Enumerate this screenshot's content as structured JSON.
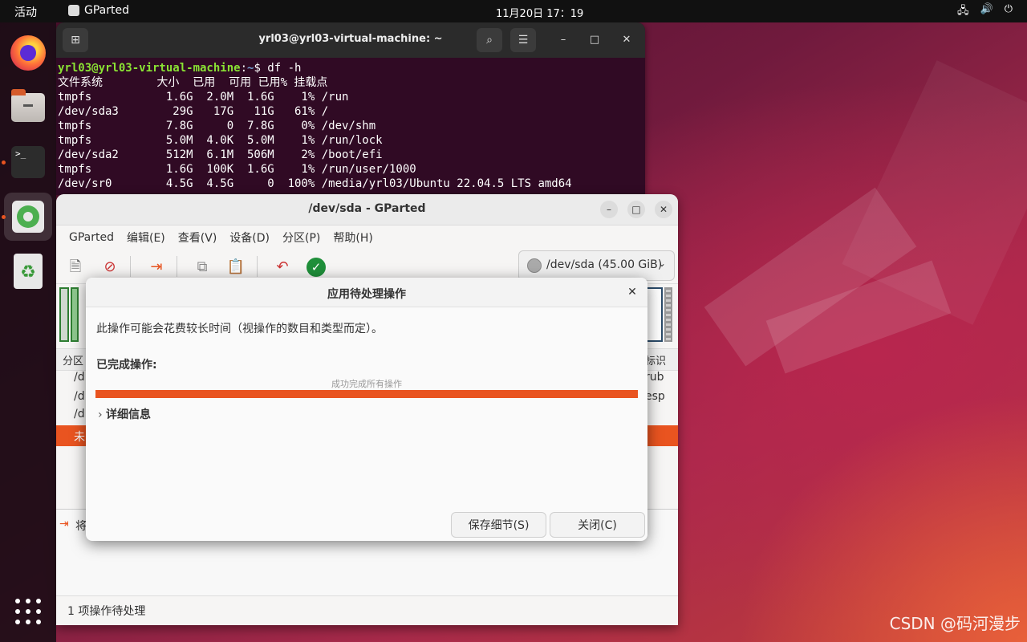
{
  "topbar": {
    "activities": "活动",
    "app_name": "GParted",
    "clock": "11月20日  17：19",
    "tray": [
      "network-icon",
      "volume-icon",
      "power-icon"
    ]
  },
  "dock": {
    "items": [
      "firefox",
      "files",
      "terminal",
      "gparted",
      "trash",
      "show-apps"
    ]
  },
  "terminal": {
    "title": "yrl03@yrl03-virtual-machine: ~",
    "prompt_user": "yrl03@yrl03-virtual-machine",
    "prompt_sep": ":",
    "prompt_path": "~",
    "prompt_cmd": "$ df -h",
    "lines": [
      "文件系统        大小  已用  可用 已用% 挂载点",
      "tmpfs           1.6G  2.0M  1.6G    1% /run",
      "/dev/sda3        29G   17G   11G   61% /",
      "tmpfs           7.8G     0  7.8G    0% /dev/shm",
      "tmpfs           5.0M  4.0K  5.0M    1% /run/lock",
      "/dev/sda2       512M  6.1M  506M    2% /boot/efi",
      "tmpfs           1.6G  100K  1.6G    1% /run/user/1000",
      "/dev/sr0        4.5G  4.5G     0  100% /media/yrl03/Ubuntu 22.04.5 LTS amd64"
    ]
  },
  "gparted": {
    "title": "/dev/sda - GParted",
    "menu": [
      "GParted",
      "编辑(E)",
      "查看(V)",
      "设备(D)",
      "分区(P)",
      "帮助(H)"
    ],
    "device": "/dev/sda (45.00 GiB)",
    "list_header_left": "分区",
    "list_header_right": "标识",
    "rows": [
      {
        "left": "/d",
        "right": "rub"
      },
      {
        "left": "/d",
        "right": "esp"
      },
      {
        "left": "/d",
        "right": ""
      }
    ],
    "unalloc_left": "未",
    "pending_left": "将",
    "status": "1 项操作待处理"
  },
  "dialog": {
    "title": "应用待处理操作",
    "description": "此操作可能会花费较长时间（视操作的数目和类型而定）。",
    "completed_label": "已完成操作:",
    "progress_text": "成功完成所有操作",
    "progress": 1.0,
    "details_label": "详细信息",
    "save_button": "保存细节(S)",
    "close_button": "关闭(C)"
  },
  "watermark": "CSDN @码河漫步",
  "colors": {
    "accent": "#e95420",
    "terminal_bg": "#300a24",
    "prompt_user": "#8ae234",
    "prompt_path": "#729fcf"
  }
}
